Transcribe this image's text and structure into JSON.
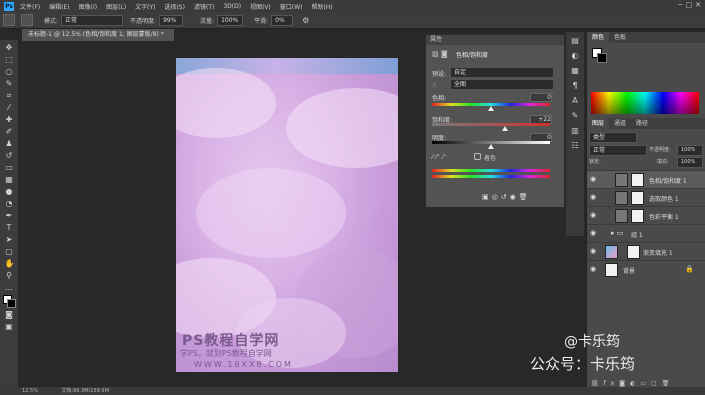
{
  "menu": {
    "items": [
      "文件(F)",
      "编辑(E)",
      "图像(I)",
      "图层(L)",
      "文字(Y)",
      "选择(S)",
      "滤镜(T)",
      "3D(D)",
      "视图(V)",
      "窗口(W)",
      "帮助(H)"
    ],
    "window_icons": [
      "─",
      "□",
      "✕"
    ]
  },
  "options": {
    "mode_label": "模式:",
    "mode_value": "正常",
    "opacity_label": "不透明度:",
    "opacity_value": "99%",
    "flow_label": "流量:",
    "flow_value": "100%",
    "smooth_label": "平滑:",
    "smooth_value": "0%"
  },
  "document": {
    "tab_title": "未标题-1 @ 12.5% (色相/饱和度 1, 图层蒙版/8) *"
  },
  "properties": {
    "header": "属性",
    "title": "色相/饱和度",
    "preset_label": "预设:",
    "preset_value": "自定",
    "channel_value": "全图",
    "hue_label": "色相:",
    "hue_value": "0",
    "saturation_label": "饱和度:",
    "saturation_value": "+22",
    "lightness_label": "明度:",
    "lightness_value": "0",
    "colorize_label": "着色"
  },
  "right_panel": {
    "color_tabs": [
      "颜色",
      "色板"
    ],
    "layer_tabs": [
      "图层",
      "通道",
      "路径"
    ],
    "kind_label": "类型",
    "blend_value": "正常",
    "opacity_label": "不透明度:",
    "opacity_value": "100%",
    "lock_label": "锁定:",
    "fill_label": "填充:",
    "fill_value": "100%",
    "layers": [
      {
        "name": "色相/饱和度 1"
      },
      {
        "name": "选取颜色 1"
      },
      {
        "name": "色彩平衡 1"
      },
      {
        "name": "组 1"
      },
      {
        "name": "渐变填充 1"
      },
      {
        "name": "背景"
      }
    ]
  },
  "watermark": {
    "line1": "PS教程自学网",
    "line2": "学PS，就到PS教程自学网",
    "line3": "WWW.16XX8.COM"
  },
  "overlay": {
    "handle": "@卡乐筠",
    "account": "公众号：卡乐筠"
  },
  "status": {
    "zoom": "12.5%",
    "doc_size": "文档:96.3M/159.5M"
  },
  "colors": {
    "accent": "#31a8ff",
    "canvas_pink": "#d9b2e6"
  }
}
